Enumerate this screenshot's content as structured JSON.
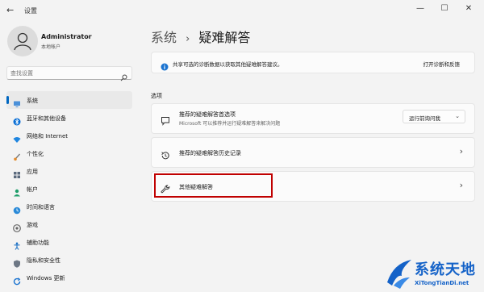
{
  "window": {
    "title": "设置",
    "back_glyph": "←",
    "minimize": "—",
    "maximize": "☐",
    "close": "✕"
  },
  "profile": {
    "name": "Administrator",
    "account_type": "本地帐户"
  },
  "search": {
    "placeholder": "查找设置"
  },
  "nav": [
    {
      "label": "系统",
      "icon": "monitor-icon",
      "selected": true
    },
    {
      "label": "蓝牙和其他设备",
      "icon": "bluetooth-icon"
    },
    {
      "label": "网络和 Internet",
      "icon": "wifi-icon"
    },
    {
      "label": "个性化",
      "icon": "brush-icon"
    },
    {
      "label": "应用",
      "icon": "apps-icon"
    },
    {
      "label": "帐户",
      "icon": "person-icon"
    },
    {
      "label": "时间和语言",
      "icon": "globe-clock-icon"
    },
    {
      "label": "游戏",
      "icon": "gamepad-icon"
    },
    {
      "label": "辅助功能",
      "icon": "accessibility-icon"
    },
    {
      "label": "隐私和安全性",
      "icon": "shield-icon"
    },
    {
      "label": "Windows 更新",
      "icon": "update-icon"
    }
  ],
  "breadcrumb": {
    "parent": "系统",
    "separator": "›",
    "current": "疑难解答"
  },
  "info_banner": {
    "text": "共享可选的诊断数据以获取其他疑难解答建议。",
    "link": "打开诊断和反馈"
  },
  "section_title": "选项",
  "cards": {
    "recommended_prefs": {
      "title": "推荐的疑难解答首选项",
      "subtitle": "Microsoft 可以推荐并运行疑难解答来解决问题",
      "dropdown_value": "运行前询问我"
    },
    "history": {
      "title": "推荐的疑难解答历史记录"
    },
    "other": {
      "title": "其他疑难解答"
    }
  },
  "chevron": "›",
  "dropdown_chevron": "⌄",
  "watermark": {
    "title": "系统天地",
    "subtitle": "XiTongTianDi.net"
  },
  "colors": {
    "accent": "#0067c0",
    "highlight_box": "#c00000",
    "watermark": "#1462c8"
  }
}
